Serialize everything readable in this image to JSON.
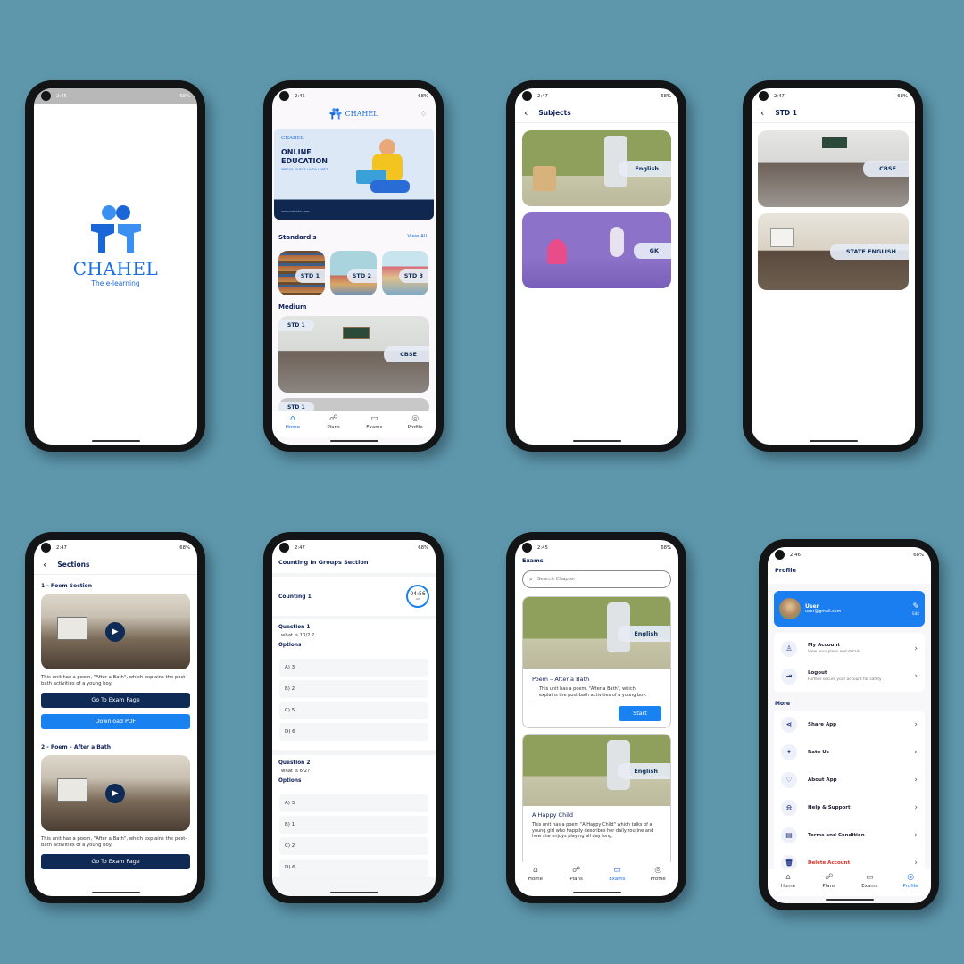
{
  "colors": {
    "background": "#5e97ac",
    "primary": "#1a6ee0",
    "navy": "#0e2a55",
    "danger": "#d93025"
  },
  "brand": {
    "name": "CHAHEL",
    "tagline": "The e-learning"
  },
  "phone1": {
    "time": "2:45",
    "status_right": "68%"
  },
  "phone2": {
    "time": "2:45",
    "status_right": "68%",
    "banner": {
      "brand": "CHAHEL",
      "headline1": "ONLINE",
      "headline2": "EDUCATION",
      "guest": "SPECIAL GUEST: LINDA LOPEZ",
      "site": "www.website.com"
    },
    "standards_title": "Standard's",
    "view_all": "View All",
    "standards": [
      "STD 1",
      "STD 2",
      "STD 3"
    ],
    "medium_title": "Medium",
    "medium_card_std": "STD 1",
    "medium_card_label": "CBSE",
    "peek_label": "STD 1",
    "nav": [
      "Home",
      "Plans",
      "Exams",
      "Profile"
    ]
  },
  "phone3": {
    "time": "2:47",
    "status_right": "68%",
    "title": "Subjects",
    "subjects": [
      "English",
      "GK"
    ]
  },
  "phone4": {
    "time": "2:47",
    "status_right": "68%",
    "title": "STD 1",
    "boards": [
      "CBSE",
      "STATE ENGLISH"
    ]
  },
  "phone5": {
    "time": "2:47",
    "status_right": "68%",
    "title": "Sections",
    "section1": "1 - Poem Section",
    "desc1": "This unit has a poem, \"After a Bath\", which explains the post-bath activities of a young boy.",
    "exam_btn": "Go To Exam Page",
    "pdf_btn": "Download PDF",
    "section2": "2 - Poem – After a Bath",
    "desc2": "This unit has a poem, \"After a Bath\", which explains the post-bath activities of a young boy.",
    "exam_btn2": "Go To Exam Page"
  },
  "phone6": {
    "time": "2:47",
    "status_right": "68%",
    "title": "Counting In Groups Section",
    "quiz": "Counting 1",
    "timer": "04:56",
    "timer_sub": "left",
    "q1": "Question 1",
    "q1_text": "what is 10/2 ?",
    "options_label": "Options",
    "q1_opts": [
      "A) 3",
      "B) 2",
      "C) 5",
      "D) 6"
    ],
    "q2": "Question 2",
    "q2_text": "what is 6/2?",
    "options_label2": "Options",
    "q2_opts": [
      "A) 3",
      "B) 1",
      "C) 2",
      "D) 6"
    ]
  },
  "phone7": {
    "time": "2:45",
    "status_right": "68%",
    "title": "Exams",
    "search_placeholder": "Search Chapter",
    "card1_label": "English",
    "card1_title": "Poem – After a Bath",
    "card1_desc": "This unit has a poem, \"After a Bath\", which explains the post-bath activities of a young boy.",
    "start": "Start",
    "card2_label": "English",
    "card2_title": "A Happy Child",
    "card2_desc": "This unit has a poem \"A Happy Child\" which talks of a young girl who happily describes her daily routine and how she enjoys playing all day long.",
    "nav": [
      "Home",
      "Plans",
      "Exams",
      "Profile"
    ]
  },
  "phone8": {
    "time": "2:46",
    "status_right": "68%",
    "title": "Profile",
    "user_name": "User",
    "user_email": "user@gmail.com",
    "edit": "Edit",
    "account": [
      {
        "label": "My Account",
        "sub": "View your plans and details",
        "icon": "user-icon",
        "glyph": "♙"
      },
      {
        "label": "Logout",
        "sub": "Further secure your account for safety",
        "icon": "logout-icon",
        "glyph": "⇥"
      }
    ],
    "more_title": "More",
    "more": [
      {
        "label": "Share App",
        "icon": "share-icon",
        "glyph": "⋖"
      },
      {
        "label": "Rate Us",
        "icon": "sparkle-icon",
        "glyph": "✦"
      },
      {
        "label": "About App",
        "icon": "heart-icon",
        "glyph": "♡"
      },
      {
        "label": "Help & Support",
        "icon": "bell-icon",
        "glyph": "⍾"
      },
      {
        "label": "Terms and Condition",
        "icon": "document-icon",
        "glyph": "▤"
      },
      {
        "label": "Delete Account",
        "icon": "trash-icon",
        "glyph": "🗑"
      }
    ],
    "nav": [
      "Home",
      "Plans",
      "Exams",
      "Profile"
    ]
  }
}
